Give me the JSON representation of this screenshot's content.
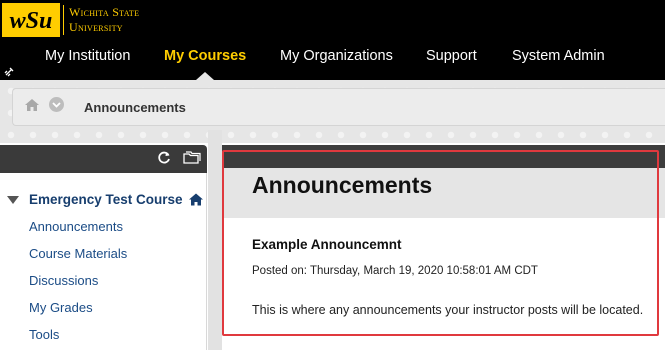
{
  "header": {
    "logo_mark_text": "wSu",
    "logo_line1": "Wichita State",
    "logo_line2": "University",
    "brand_color": "#ffcd00"
  },
  "nav": {
    "items": [
      {
        "label": "My Institution"
      },
      {
        "label": "My Courses",
        "active": true
      },
      {
        "label": "My Organizations"
      },
      {
        "label": "Support"
      },
      {
        "label": "System Admin"
      }
    ]
  },
  "breadcrumb": {
    "current": "Announcements"
  },
  "course_menu": {
    "course_title": "Emergency Test Course",
    "items": [
      {
        "label": "Announcements"
      },
      {
        "label": "Course Materials"
      },
      {
        "label": "Discussions"
      },
      {
        "label": "My Grades"
      },
      {
        "label": "Tools"
      }
    ]
  },
  "main": {
    "page_title": "Announcements",
    "announcement": {
      "title": "Example Announcemnt",
      "posted": "Posted on: Thursday, March 19, 2020 10:58:01 AM CDT",
      "body": "This is where any announcements your instructor posts will be located."
    }
  },
  "colors": {
    "highlight": "#e0393e",
    "link": "#1b4c86"
  }
}
